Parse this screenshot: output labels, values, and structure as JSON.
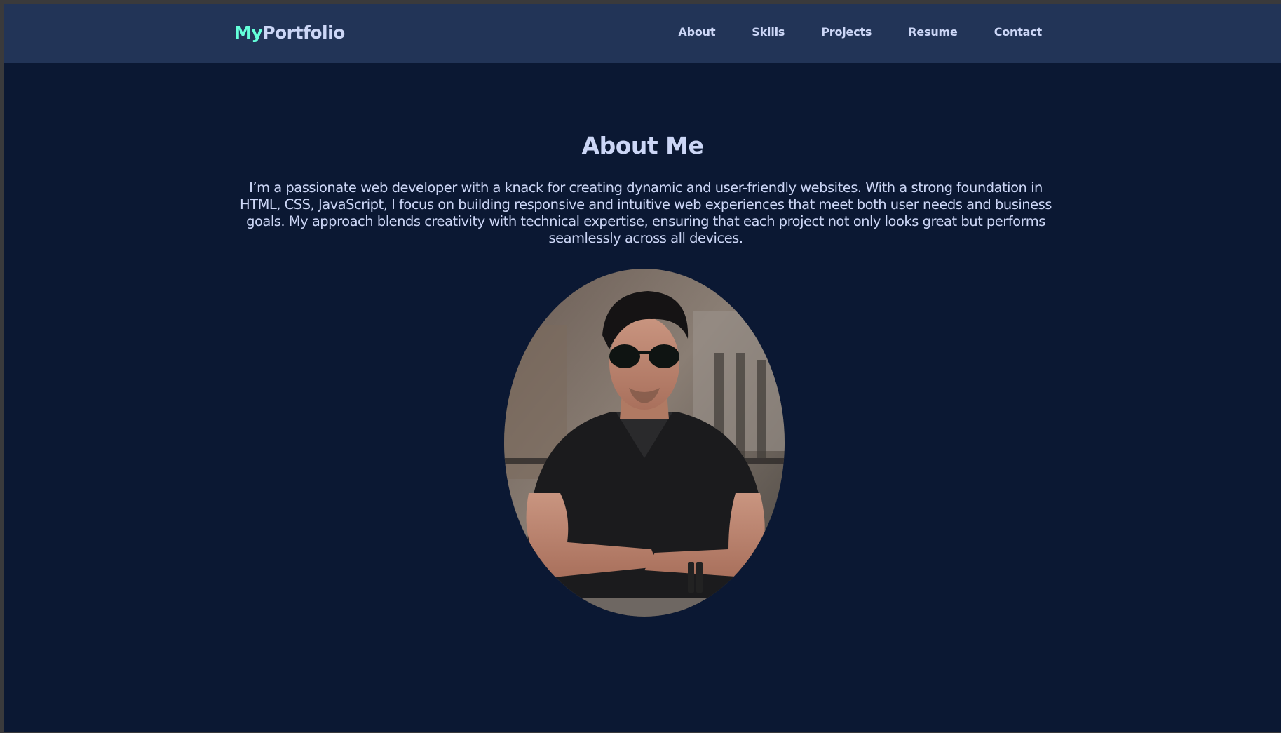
{
  "brand": {
    "accent_text": "My",
    "rest_text": "Portfolio"
  },
  "nav": {
    "items": [
      {
        "label": "About"
      },
      {
        "label": "Skills"
      },
      {
        "label": "Projects"
      },
      {
        "label": "Resume"
      },
      {
        "label": "Contact"
      }
    ]
  },
  "about": {
    "title": "About Me",
    "body": "I’m a passionate web developer with a knack for creating dynamic and user-friendly websites. With a strong foundation in HTML, CSS, JavaScript, I focus on building responsive and intuitive web experiences that meet both user needs and business goals. My approach blends creativity with technical expertise, ensuring that each project not only looks great but performs seamlessly across all devices."
  },
  "colors": {
    "navbar_bg": "#223457",
    "page_bg": "#0b1833",
    "accent": "#64ffda",
    "text": "#ccd6f6"
  }
}
